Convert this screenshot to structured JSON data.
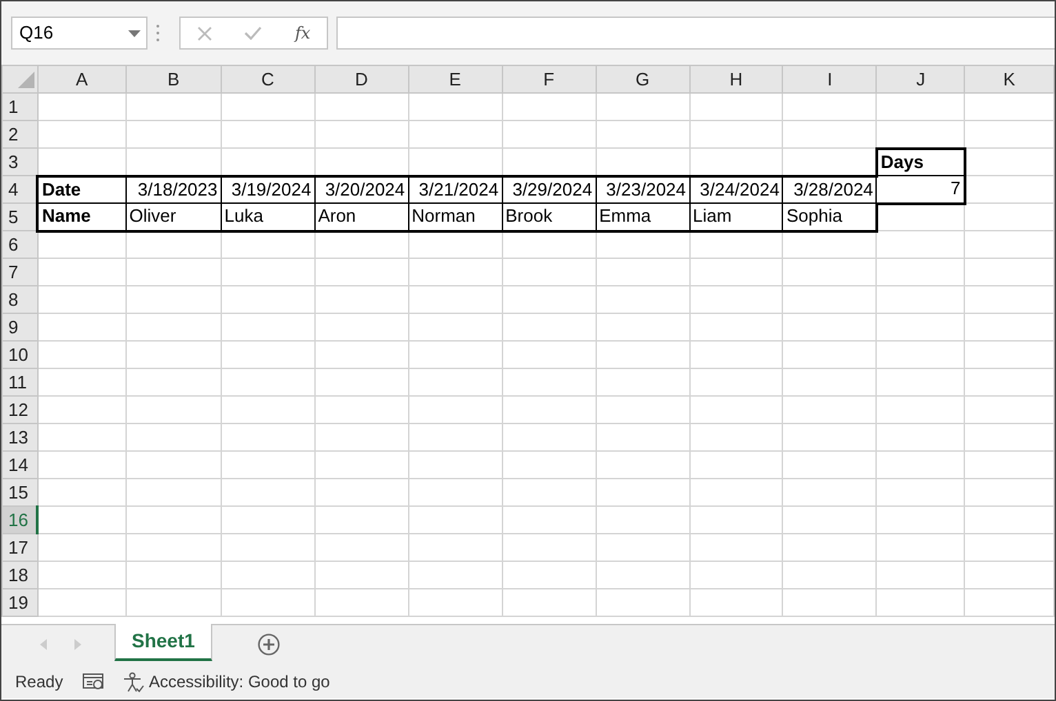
{
  "formula_bar": {
    "name_box": "Q16",
    "function_label": "fx"
  },
  "columns": [
    {
      "label": "A",
      "selected": false
    },
    {
      "label": "B",
      "selected": false
    },
    {
      "label": "C",
      "selected": false
    },
    {
      "label": "D",
      "selected": false
    },
    {
      "label": "E",
      "selected": false
    },
    {
      "label": "F",
      "selected": false
    },
    {
      "label": "G",
      "selected": false
    },
    {
      "label": "H",
      "selected": false
    },
    {
      "label": "I",
      "selected": false
    },
    {
      "label": "J",
      "selected": false
    },
    {
      "label": "K",
      "selected": false
    }
  ],
  "rows": [
    {
      "label": "1",
      "selected": false
    },
    {
      "label": "2",
      "selected": false
    },
    {
      "label": "3",
      "selected": false,
      "cells": {
        "J": {
          "value": "Days",
          "kind": "text",
          "bold": true,
          "bordered": true
        }
      }
    },
    {
      "label": "4",
      "selected": false,
      "cells": {
        "A": {
          "value": "Date",
          "kind": "text",
          "bold": true,
          "bordered": true
        },
        "B": {
          "value": "3/18/2023",
          "kind": "number",
          "bold": false,
          "bordered": true
        },
        "C": {
          "value": "3/19/2024",
          "kind": "number",
          "bold": false,
          "bordered": true
        },
        "D": {
          "value": "3/20/2024",
          "kind": "number",
          "bold": false,
          "bordered": true
        },
        "E": {
          "value": "3/21/2024",
          "kind": "number",
          "bold": false,
          "bordered": true
        },
        "F": {
          "value": "3/29/2024",
          "kind": "number",
          "bold": false,
          "bordered": true
        },
        "G": {
          "value": "3/23/2024",
          "kind": "number",
          "bold": false,
          "bordered": true
        },
        "H": {
          "value": "3/24/2024",
          "kind": "number",
          "bold": false,
          "bordered": true
        },
        "I": {
          "value": "3/28/2024",
          "kind": "number",
          "bold": false,
          "bordered": true
        },
        "J": {
          "value": "7",
          "kind": "number",
          "bold": false,
          "bordered": true
        }
      }
    },
    {
      "label": "5",
      "selected": false,
      "cells": {
        "A": {
          "value": "Name",
          "kind": "text",
          "bold": true,
          "bordered": true
        },
        "B": {
          "value": "Oliver",
          "kind": "text",
          "bold": false,
          "bordered": true
        },
        "C": {
          "value": "Luka",
          "kind": "text",
          "bold": false,
          "bordered": true
        },
        "D": {
          "value": "Aron",
          "kind": "text",
          "bold": false,
          "bordered": true
        },
        "E": {
          "value": "Norman",
          "kind": "text",
          "bold": false,
          "bordered": true
        },
        "F": {
          "value": "Brook",
          "kind": "text",
          "bold": false,
          "bordered": true
        },
        "G": {
          "value": "Emma",
          "kind": "text",
          "bold": false,
          "bordered": true
        },
        "H": {
          "value": "Liam",
          "kind": "text",
          "bold": false,
          "bordered": true
        },
        "I": {
          "value": "Sophia",
          "kind": "text",
          "bold": false,
          "bordered": true
        }
      }
    },
    {
      "label": "6",
      "selected": false
    },
    {
      "label": "7",
      "selected": false
    },
    {
      "label": "8",
      "selected": false
    },
    {
      "label": "9",
      "selected": false
    },
    {
      "label": "10",
      "selected": false
    },
    {
      "label": "11",
      "selected": false
    },
    {
      "label": "12",
      "selected": false
    },
    {
      "label": "13",
      "selected": false
    },
    {
      "label": "14",
      "selected": false
    },
    {
      "label": "15",
      "selected": false
    },
    {
      "label": "16",
      "selected": true
    },
    {
      "label": "17",
      "selected": false
    },
    {
      "label": "18",
      "selected": false
    },
    {
      "label": "19",
      "selected": false
    }
  ],
  "sheet_tabs": [
    {
      "label": "Sheet1",
      "selected": true
    }
  ],
  "status_bar": {
    "mode": "Ready",
    "accessibility": "Accessibility: Good to go"
  }
}
